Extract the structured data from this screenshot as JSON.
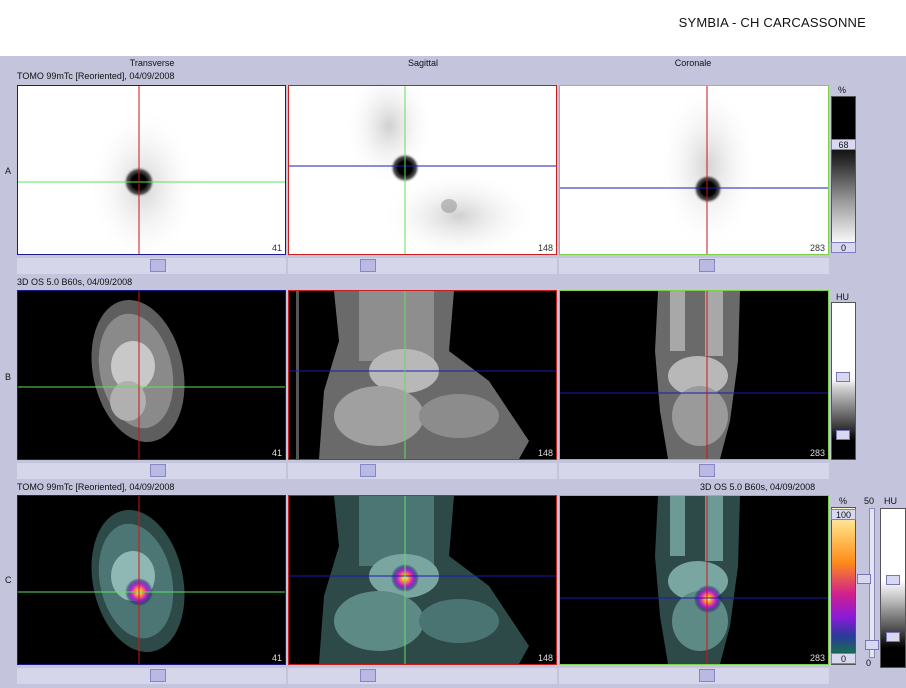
{
  "header": {
    "title": "SYMBIA - CH CARCASSONNE"
  },
  "columns": {
    "transverse": "Transverse",
    "sagittal": "Sagittal",
    "coronal": "Coronale"
  },
  "rows": {
    "a": {
      "label": "A",
      "series": "TOMO 99mTc [Reoriented], 04/09/2008"
    },
    "b": {
      "label": "B",
      "series": "3D  OS  5.0  B60s, 04/09/2008"
    },
    "c": {
      "label": "C",
      "series_left": "TOMO 99mTc [Reoriented], 04/09/2008",
      "series_right": "3D  OS  5.0  B60s, 04/09/2008"
    }
  },
  "slices": {
    "transverse": "41",
    "sagittal": "148",
    "coronal": "283"
  },
  "colorbars": {
    "a": {
      "unit": "%",
      "level": "68",
      "min": "0"
    },
    "b": {
      "unit": "HU"
    },
    "c": {
      "unit": "%",
      "max": "100",
      "min": "0",
      "ct_unit": "HU",
      "blend": "50",
      "blend_min": "0"
    }
  },
  "colors": {
    "transverse_frame": "#1a1a8c",
    "sagittal_frame": "#c81e1e",
    "coronal_frame": "#7ed04a",
    "crosshair_red": "#d21414",
    "crosshair_green": "#5ee05e",
    "crosshair_blue": "#1a1ab4",
    "panel_bg": "#c4c4dc"
  }
}
